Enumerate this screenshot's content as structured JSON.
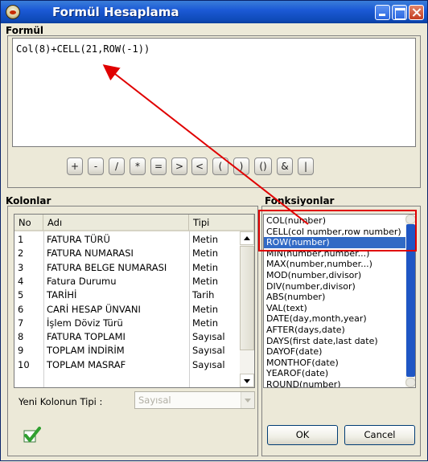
{
  "window": {
    "title": "Formül Hesaplama"
  },
  "formula": {
    "label": "Formül",
    "text": "Col(8)+CELL(21,ROW(-1))"
  },
  "operators": [
    "+",
    "-",
    "/",
    "*",
    "=",
    ">",
    "<",
    "(",
    ")",
    "()",
    "&",
    "|"
  ],
  "columns": {
    "label": "Kolonlar",
    "headers": {
      "no": "No",
      "name": "Adı",
      "type": "Tipi"
    },
    "rows": [
      {
        "no": "1",
        "name": "FATURA TÜRÜ",
        "type": "Metin"
      },
      {
        "no": "2",
        "name": "FATURA NUMARASI",
        "type": "Metin"
      },
      {
        "no": "3",
        "name": "FATURA BELGE NUMARASI",
        "type": "Metin"
      },
      {
        "no": "4",
        "name": "Fatura Durumu",
        "type": "Metin"
      },
      {
        "no": "5",
        "name": "TARİHİ",
        "type": "Tarih"
      },
      {
        "no": "6",
        "name": "CARİ HESAP ÜNVANI",
        "type": "Metin"
      },
      {
        "no": "7",
        "name": "İşlem Döviz Türü",
        "type": "Metin"
      },
      {
        "no": "8",
        "name": "FATURA TOPLAMI",
        "type": "Sayısal"
      },
      {
        "no": "9",
        "name": "TOPLAM İNDİRİM",
        "type": "Sayısal"
      },
      {
        "no": "10",
        "name": "TOPLAM MASRAF",
        "type": "Sayısal"
      }
    ],
    "new_column_type_label": "Yeni Kolonun Tipi :",
    "new_column_type_value": "Sayısal"
  },
  "functions": {
    "label": "Fonksiyonlar",
    "items": [
      "COL(number)",
      "CELL(col number,row number)",
      "ROW(number)",
      "MIN(number,number...)",
      "MAX(number,number...)",
      "MOD(number,divisor)",
      "DIV(number,divisor)",
      "ABS(number)",
      "VAL(text)",
      "DATE(day,month,year)",
      "AFTER(days,date)",
      "DAYS(first date,last date)",
      "DAYOF(date)",
      "MONTHOF(date)",
      "YEAROF(date)",
      "ROUND(number)"
    ],
    "selected": "ROW(number)"
  },
  "buttons": {
    "ok": "OK",
    "cancel": "Cancel"
  },
  "colors": {
    "titlebar": "#1c5ad6",
    "selection": "#316ac5",
    "annotation": "#e00000",
    "check": "#2fa02f"
  },
  "icons": [
    "app-icon",
    "minimize-icon",
    "maximize-icon",
    "close-icon",
    "checkmark-icon"
  ]
}
